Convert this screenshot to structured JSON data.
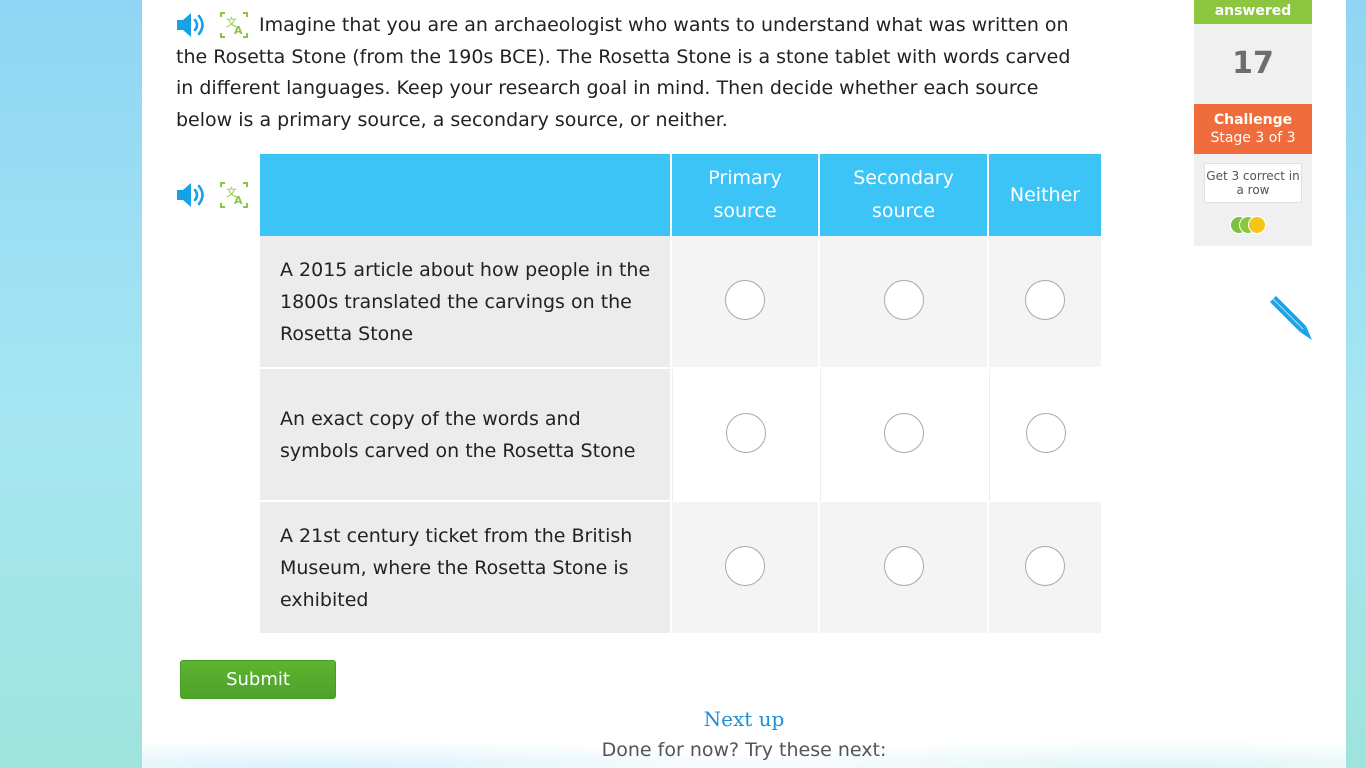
{
  "question": {
    "text": "Imagine that you are an archaeologist who wants to understand what was written on the Rosetta Stone (from the 190s BCE). The Rosetta Stone is a stone tablet with words carved in different languages. Keep your research goal in mind. Then decide whether each source below is a primary source, a secondary source, or neither."
  },
  "table": {
    "columns": [
      "Primary source",
      "Secondary source",
      "Neither"
    ],
    "rows": [
      "A 2015 article about how people in the 1800s translated the carvings on the Rosetta Stone",
      "An exact copy of the words and symbols carved on the Rosetta Stone",
      "A 21st century ticket from the British Museum, where the Rosetta Stone is exhibited"
    ]
  },
  "submit_label": "Submit",
  "next_up": {
    "title": "Next up",
    "subtitle": "Done for now? Try these next:"
  },
  "sidebar": {
    "answered_label": "answered",
    "answered_count": "17",
    "challenge_title": "Challenge",
    "challenge_stage": "Stage 3 of 3",
    "streak_note": "Get 3 correct in a row",
    "streak_colors": [
      "#7ac143",
      "#8cc63f",
      "#f5c518"
    ]
  },
  "icons": {
    "audio": "speaker-icon",
    "translate": "translate-icon",
    "scratchpad": "pencil-icon"
  },
  "colors": {
    "header_blue": "#3cc4f6",
    "submit_green": "#5cb531",
    "challenge_orange": "#ef6c3c",
    "answered_green": "#8cc63f"
  }
}
